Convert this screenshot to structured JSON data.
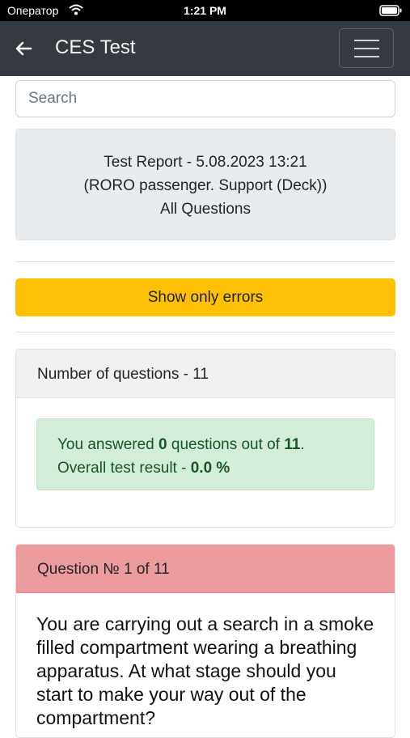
{
  "status_bar": {
    "carrier": "Оператор",
    "time": "1:21 PM"
  },
  "navbar": {
    "title": "CES Test",
    "back_icon": "arrow-left",
    "menu_icon": "hamburger"
  },
  "search": {
    "placeholder": "Search"
  },
  "report": {
    "line1": "Test Report - 5.08.2023 13:21",
    "line2": "(RORO passenger. Support (Deck))",
    "line3": "All Questions"
  },
  "actions": {
    "show_errors_label": "Show only errors"
  },
  "summary": {
    "header": "Number of questions - 11",
    "answered_prefix": "You answered ",
    "answered_count": "0",
    "answered_mid": " questions out of ",
    "total": "11",
    "answered_suffix": ".",
    "result_prefix": "Overall test result - ",
    "result_value": "0.0 %"
  },
  "question": {
    "header": "Question № 1 of 11",
    "text": "You are carrying out a search in a smoke filled compartment wearing a breathing apparatus. At what stage should you start to make your way out of the compartment?"
  },
  "colors": {
    "navbar": "#343a40",
    "warning_button": "#ffc107",
    "success_alert": "#d4edda",
    "success_text": "#155724",
    "error_header": "#eb9b9e"
  }
}
